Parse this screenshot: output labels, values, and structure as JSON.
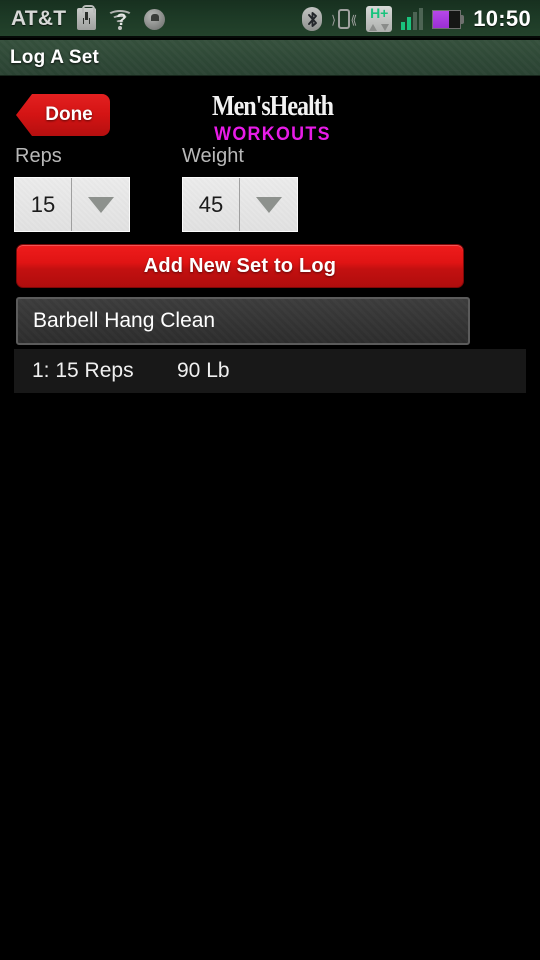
{
  "status_bar": {
    "carrier": "AT&T",
    "clock": "10:50",
    "icons": [
      "download-icon",
      "wifi-question-icon",
      "account-icon",
      "bluetooth-icon",
      "vibrate-icon",
      "hplus-data-icon",
      "signal-bars-icon",
      "battery-icon"
    ],
    "data_badge": "H+",
    "signal_bars_lit": 2,
    "signal_bars_total": 4,
    "battery_percent": 60,
    "battery_color": "#a933dd"
  },
  "title_bar": {
    "title": "Log A Set",
    "background_color": "#2e4836"
  },
  "header": {
    "done_label": "Done",
    "done_color": "#d41414",
    "brand_top": "Men'sHealth",
    "brand_bottom": "WORKOUTS",
    "brand_accent_color": "#e81ce8"
  },
  "form": {
    "reps": {
      "label": "Reps",
      "value": "15"
    },
    "weight": {
      "label": "Weight",
      "value": "45"
    },
    "add_set_label": "Add New Set to Log",
    "add_set_color": "#d41414"
  },
  "exercise": {
    "name": "Barbell Hang Clean"
  },
  "set_log": {
    "rows": [
      {
        "reps": "1: 15 Reps",
        "weight": "90 Lb"
      }
    ]
  }
}
